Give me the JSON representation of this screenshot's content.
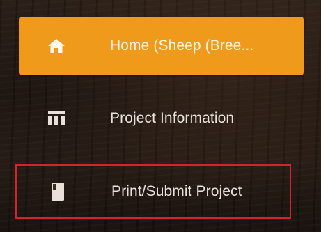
{
  "nav": {
    "items": [
      {
        "label": "Home (Sheep (Bree...",
        "icon": "home-icon",
        "active": true
      },
      {
        "label": "Project Information",
        "icon": "table-icon",
        "active": false
      },
      {
        "label": "Print/Submit Project",
        "icon": "book-icon",
        "active": false,
        "highlighted": true
      }
    ]
  },
  "colors": {
    "active_background": "#ef9a1b",
    "highlight_border": "#d4232c",
    "text": "#e9e2db",
    "background": "#231a14"
  }
}
